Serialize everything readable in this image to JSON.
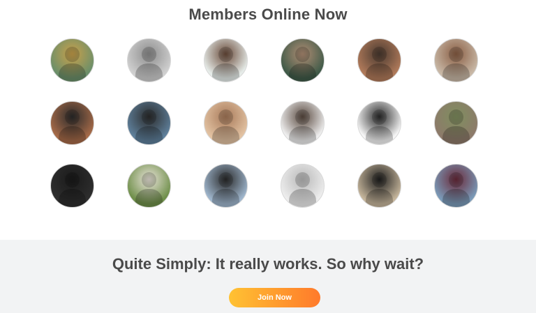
{
  "members": {
    "title": "Members Online Now",
    "avatars": [
      {
        "color": "#6b8f6a",
        "accent": "#c9a04a"
      },
      {
        "color": "#cfcfcf",
        "accent": "#8d8d8d"
      },
      {
        "color": "#e6ece9",
        "accent": "#6a4b3a"
      },
      {
        "color": "#3f5a48",
        "accent": "#b08d74"
      },
      {
        "color": "#b07a5a",
        "accent": "#4a3a30"
      },
      {
        "color": "#c8b8a6",
        "accent": "#8a5e44"
      },
      {
        "color": "#a56a48",
        "accent": "#2b2b2b"
      },
      {
        "color": "#5e7f9a",
        "accent": "#2c2c2c"
      },
      {
        "color": "#e2c2a2",
        "accent": "#a87a5a"
      },
      {
        "color": "#eeeeee",
        "accent": "#5a4a40"
      },
      {
        "color": "#f5f5f5",
        "accent": "#2a2a2a"
      },
      {
        "color": "#8d7a6a",
        "accent": "#7f8f5f"
      },
      {
        "color": "#2e2e2e",
        "accent": "#1a1a1a"
      },
      {
        "color": "#6f8f4a",
        "accent": "#e8e2d8"
      },
      {
        "color": "#9eb5cc",
        "accent": "#2a2a2a"
      },
      {
        "color": "#ededed",
        "accent": "#b9b9b9"
      },
      {
        "color": "#c4b49a",
        "accent": "#1e1e1e"
      },
      {
        "color": "#7a9ab8",
        "accent": "#6a2a3a"
      }
    ]
  },
  "cta": {
    "title": "Quite Simply: It really works. So why wait?",
    "button_label": "Join Now",
    "button_gradient": [
      "#ffc233",
      "#ff7a2b"
    ]
  }
}
